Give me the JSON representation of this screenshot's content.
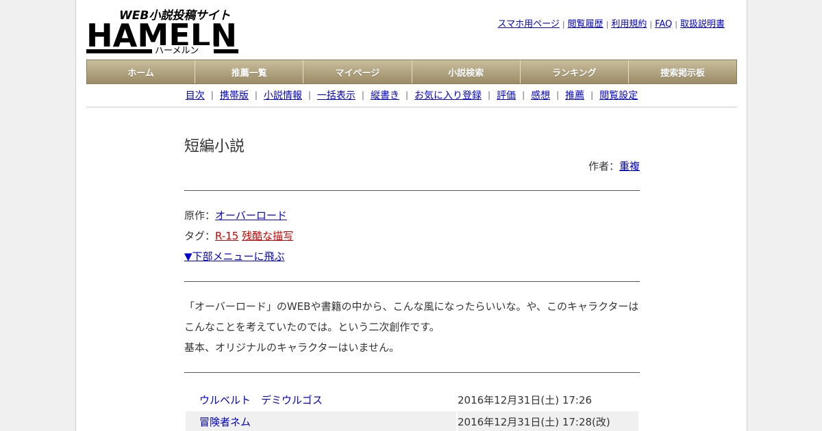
{
  "logo": {
    "top_text": "WEB小説投稿サイト",
    "main_text": "HAMELN",
    "sub_text": "ハーメルン"
  },
  "top_links": [
    "スマホ用ページ",
    "閲覧履歴",
    "利用規約",
    "FAQ",
    "取扱説明書"
  ],
  "global_nav": [
    "ホーム",
    "推薦一覧",
    "マイページ",
    "小説検索",
    "ランキング",
    "捜索掲示板"
  ],
  "sub_nav": [
    "目次",
    "携帯版",
    "小説情報",
    "一括表示",
    "縦書き",
    "お気に入り登録",
    "評価",
    "感想",
    "推薦",
    "閲覧設定"
  ],
  "novel": {
    "title": "短編小説",
    "author_label": "作者：",
    "author": "重複",
    "original_label": "原作：",
    "original": "オーバーロード",
    "tag_label": "タグ：",
    "tags": [
      "R-15",
      "残酷な描写"
    ],
    "jump_link": "▼下部メニューに飛ぶ",
    "summary": [
      "「オーバーロード」のWEBや書籍の中から、こんな風になったらいいな。や、このキャラクターは",
      "こんなことを考えていたのでは。という二次創作です。",
      "基本、オリジナルのキャラクターはいません。"
    ]
  },
  "chapters": [
    {
      "title": "ウルベルト　デミウルゴス",
      "date": "2016年12月31日(土) 17:26",
      "revised": ""
    },
    {
      "title": "冒険者ネム",
      "date": "2016年12月31日(土) 17:28(",
      "revised": "改"
    }
  ],
  "colors": {
    "nav_top": "#c9bd9d",
    "nav_bottom": "#9a8c66",
    "link": "#0000cc",
    "tag": "#cc0000"
  }
}
